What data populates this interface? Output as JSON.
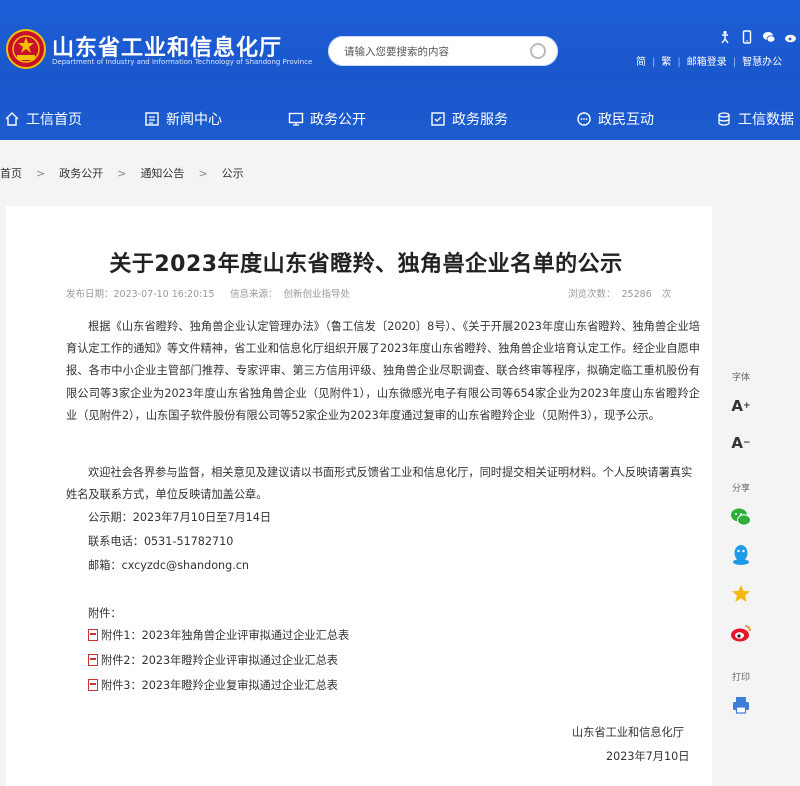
{
  "header": {
    "site_name": "山东省工业和信息化厅",
    "site_name_en": "Department of Industry and Information Technology of Shandong Province",
    "search_placeholder": "请输入您要搜索的内容",
    "links": [
      "简",
      "繁",
      "邮箱登录",
      "智慧办公"
    ]
  },
  "nav": [
    {
      "label": "工信首页",
      "icon": "home-icon"
    },
    {
      "label": "新闻中心",
      "icon": "news-icon"
    },
    {
      "label": "政务公开",
      "icon": "monitor-icon"
    },
    {
      "label": "政务服务",
      "icon": "service-icon"
    },
    {
      "label": "政民互动",
      "icon": "interaction-icon"
    },
    {
      "label": "工信数据",
      "icon": "database-icon"
    }
  ],
  "breadcrumb": [
    "首页",
    "政务公开",
    "通知公告",
    "公示"
  ],
  "article": {
    "title": "关于2023年度山东省瞪羚、独角兽企业名单的公示",
    "publish_label": "发布日期：2023-07-10 16:20:15",
    "source_label": "信息来源：",
    "source_value": "创新创业指导处",
    "views_label": "浏览次数：",
    "views_value": "25286",
    "views_unit": "次",
    "para1": "根据《山东省瞪羚、独角兽企业认定管理办法》（鲁工信发〔2020〕8号）、《关于开展2023年度山东省瞪羚、独角兽企业培育认定工作的通知》等文件精神，省工业和信息化厅组织开展了2023年度山东省瞪羚、独角兽企业培育认定工作。经企业自愿申报、各市中小企业主管部门推荐、专家评审、第三方信用评级、独角兽企业尽职调查、联合终审等程序，拟确定临工重机股份有限公司等3家企业为2023年度山东省独角兽企业（见附件1），山东微感光电子有限公司等654家企业为2023年度山东省瞪羚企业（见附件2），山东国子软件股份有限公司等52家企业为2023年度通过复审的山东省瞪羚企业（见附件3），现予公示。",
    "para2": "欢迎社会各界参与监督，相关意见及建议请以书面形式反馈省工业和信息化厅，同时提交相关证明材料。个人反映请署真实姓名及联系方式，单位反映请加盖公章。",
    "period": "公示期：2023年7月10日至7月14日",
    "phone": "联系电话：0531-51782710",
    "email": "邮箱：cxcyzdc@shandong.cn",
    "attachments_label": "附件：",
    "attachments": [
      "附件1：2023年独角兽企业评审拟通过企业汇总表",
      "附件2：2023年瞪羚企业评审拟通过企业汇总表",
      "附件3：2023年瞪羚企业复审拟通过企业汇总表"
    ],
    "signature": "山东省工业和信息化厅",
    "date": "2023年7月10日"
  },
  "sidebar": {
    "font_label": "字体",
    "font_increase": "A",
    "font_decrease": "A",
    "share_label": "分享",
    "print_label": "打印"
  },
  "colors": {
    "header_blue": "#1a57cc",
    "wechat_green": "#2fae3a",
    "qq_blue": "#1e9be8",
    "qzone_yellow": "#f5b90c",
    "weibo_red": "#e6162d",
    "print_blue": "#3d7fd6"
  }
}
